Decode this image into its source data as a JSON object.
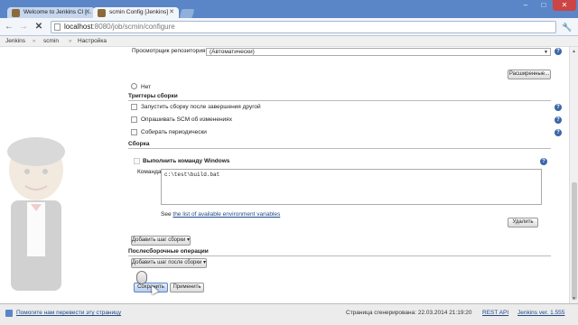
{
  "browser": {
    "tabs": [
      {
        "title": "Welcome to Jenkins CI [..."
      },
      {
        "title": "scmin Config [Jenkins]"
      }
    ],
    "window_controls": {
      "minimize": "–",
      "maximize": "□",
      "close": "✕"
    },
    "url_host": "localhost",
    "url_rest": ":8080/job/scmin/configure"
  },
  "breadcrumbs": [
    "Jenkins",
    "scmin",
    "Настройка"
  ],
  "form": {
    "repo_browser_label": "Просмотрщик репозитория",
    "repo_browser_value": "(Автоматически)",
    "advanced_button": "Расширенные...",
    "none_radio_label": "Нет",
    "build_triggers": {
      "title": "Триггеры сборки",
      "options": [
        "Запустить сборку после завершения другой",
        "Опрашивать SCM об изменениях",
        "Собирать периодически"
      ]
    },
    "build": {
      "title": "Сборка",
      "step_title": "Выполнить команду Windows",
      "command_label": "Команда",
      "command_value": "c:\\test\\build.bat",
      "see_prefix": "See",
      "see_link": "the list of available environment variables",
      "delete_button": "Удалить",
      "add_step_button": "Добавить шаг сборки"
    },
    "post_build": {
      "title": "Послесборочные операции",
      "add_step_button": "Добавить шаг после сборки"
    },
    "save_button": "Сохранить",
    "apply_button": "Применить"
  },
  "footer": {
    "translate_link": "Помогите нам перевести эту страницу",
    "generated_text": "Страница сгенерирована: 22.03.2014 21:19:20",
    "rest_api": "REST API",
    "version": "Jenkins ver. 1.555"
  }
}
